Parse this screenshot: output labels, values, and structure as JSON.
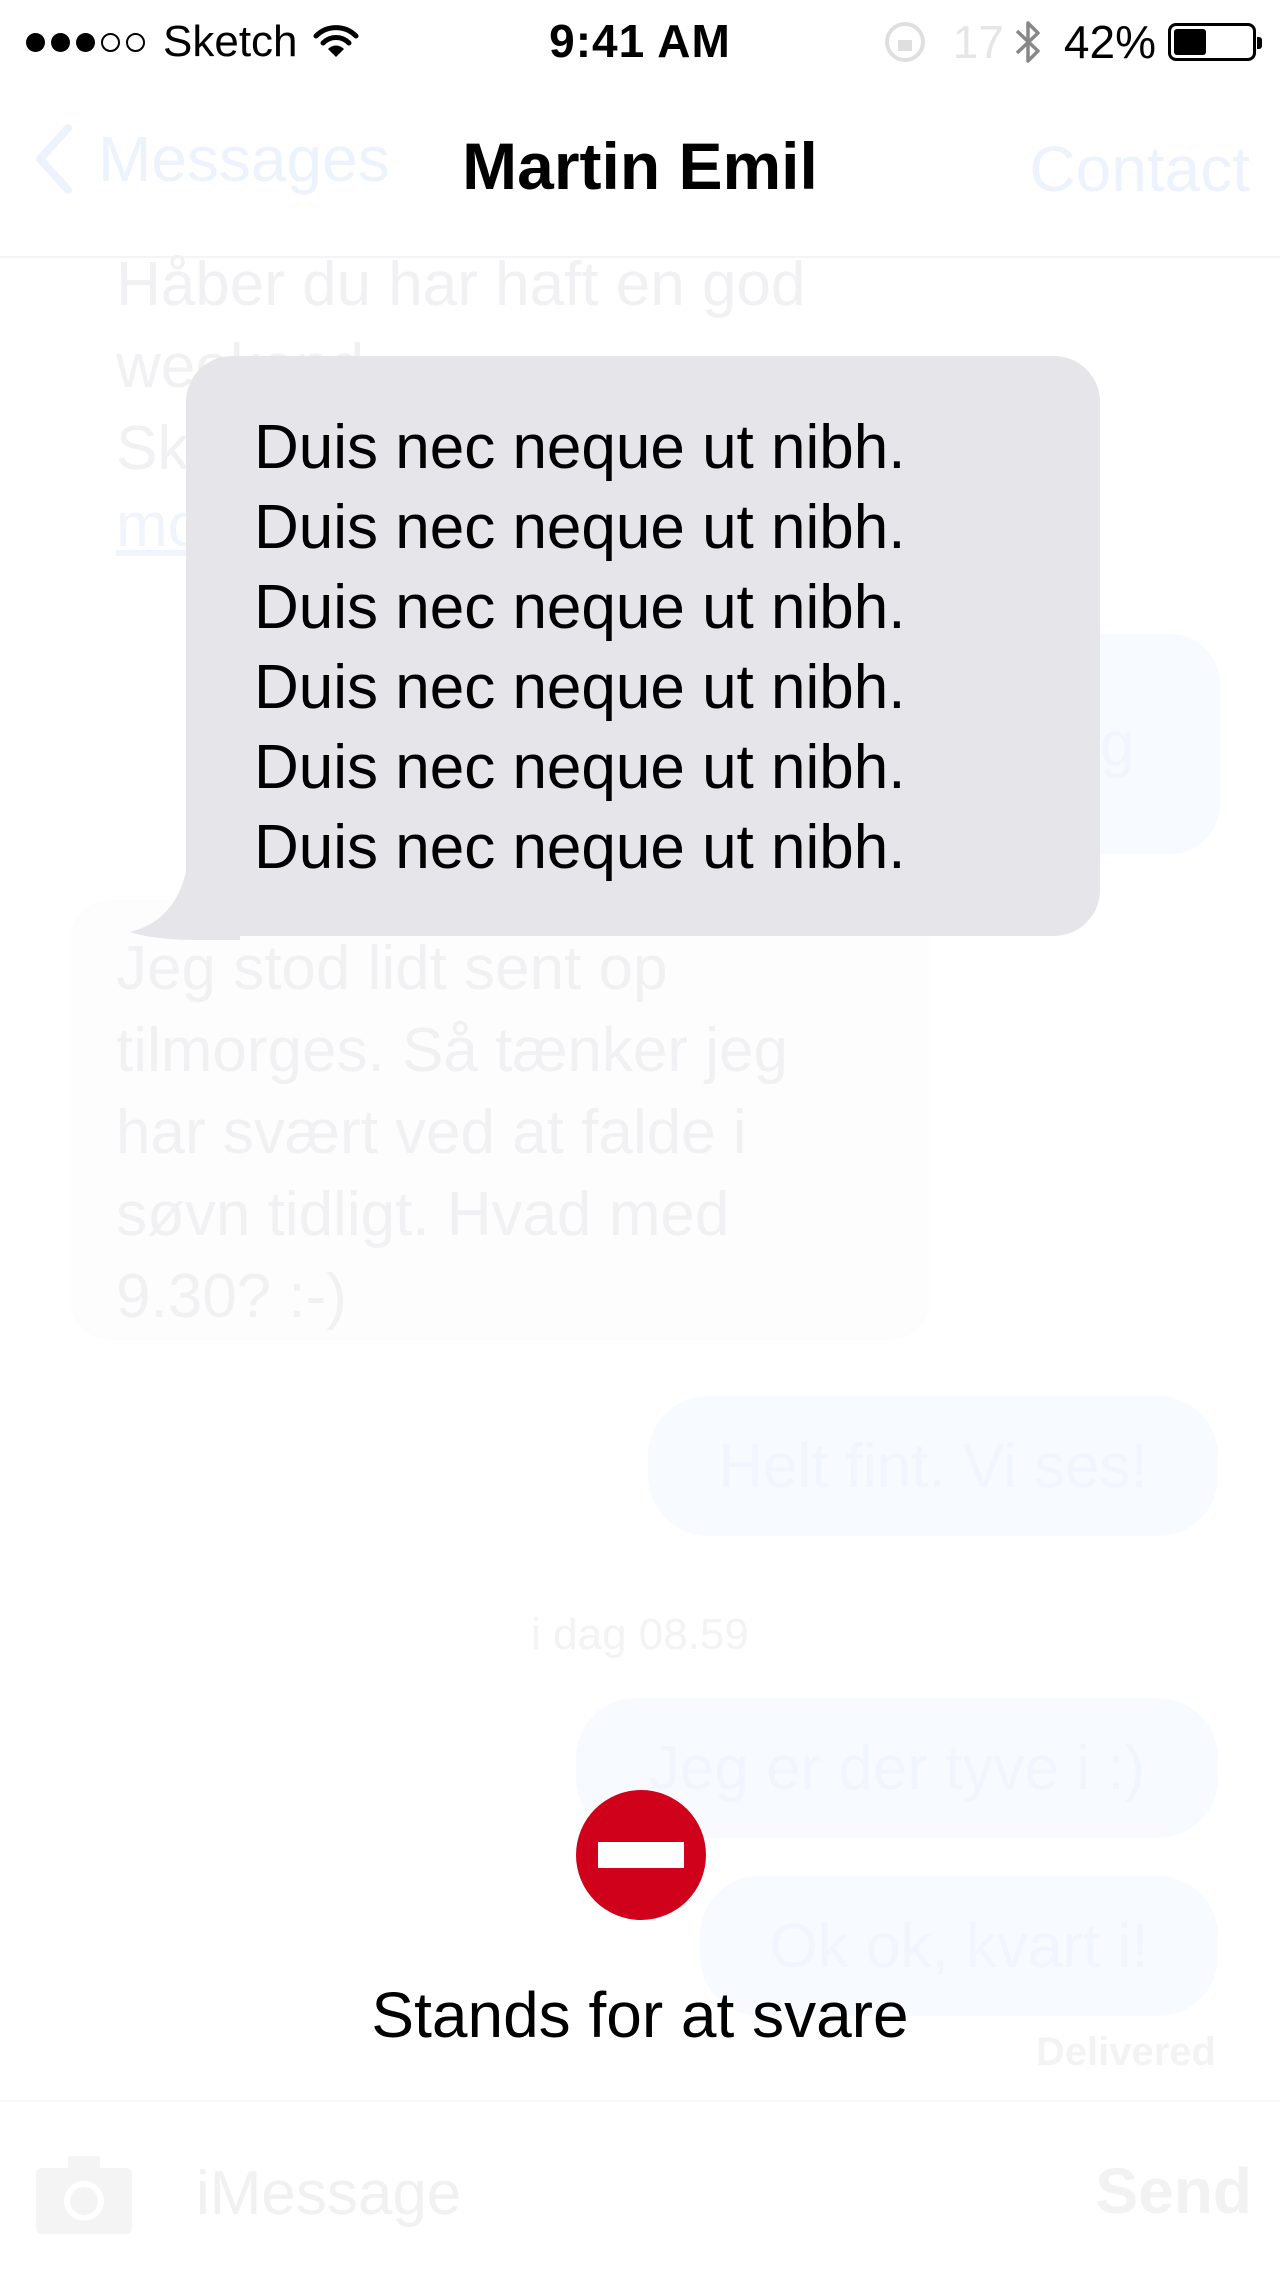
{
  "status_bar": {
    "carrier": "Sketch",
    "time": "9:41 AM",
    "hidden_number": "17",
    "battery": "42%",
    "battery_level": 0.42
  },
  "nav": {
    "back_label": "Messages",
    "title": "Martin Emil",
    "right_label": "Contact"
  },
  "background_conversation": {
    "incoming_1_lines": [
      "Håber du har haft en god",
      "weekend",
      "Sk"
    ],
    "incoming_1_link": "mo",
    "outgoing_link_fragment": "g",
    "incoming_2_lines": [
      "Jeg stod lidt sent op",
      "tilmorges. Så tænker jeg",
      "har svært ved at falde i",
      "søvn tidligt. Hvad med",
      "9.30? :-)"
    ],
    "outgoing_1": "Helt fint. Vi ses!",
    "timestamp": "i dag 08.59",
    "outgoing_2": "Jeg er der tyve i :)",
    "outgoing_3": "Ok ok, kvart i!",
    "delivered": "Delivered"
  },
  "input_bar": {
    "placeholder": "iMessage",
    "send_label": "Send"
  },
  "popup": {
    "lines": [
      "Duis nec neque ut nibh.",
      "Duis nec neque ut nibh.",
      "Duis nec neque ut nibh.",
      "Duis nec neque ut nibh.",
      "Duis nec neque ut nibh.",
      "Duis nec neque ut nibh."
    ]
  },
  "alert": {
    "icon": "no-entry-icon",
    "icon_color": "#d0021b",
    "label": "Stands for at svare"
  },
  "colors": {
    "bubble_gray": "#e5e5ea",
    "faded_blue": "#edf3fd"
  }
}
